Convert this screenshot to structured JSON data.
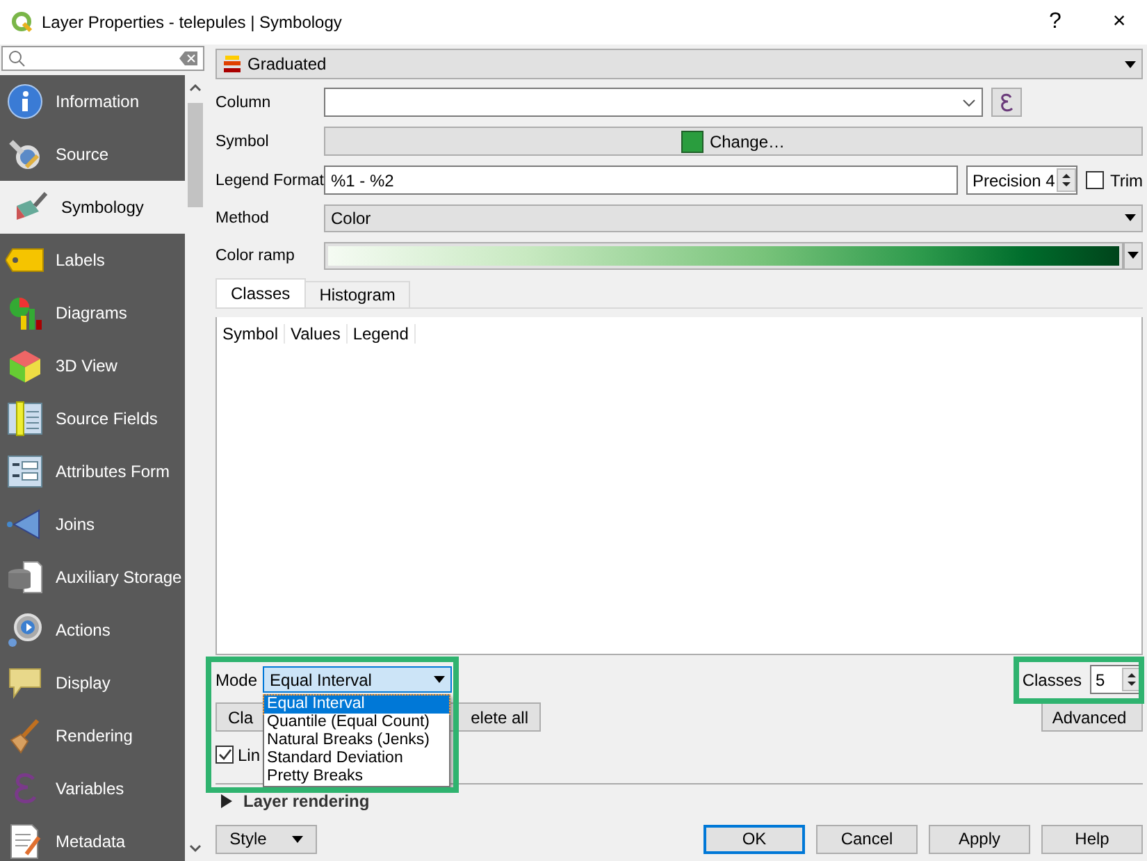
{
  "window": {
    "title": "Layer Properties - telepules | Symbology",
    "help_button": "?",
    "close_button": "×"
  },
  "sidebar": {
    "items": [
      {
        "label": "Information",
        "selected": false
      },
      {
        "label": "Source",
        "selected": false
      },
      {
        "label": "Symbology",
        "selected": true
      },
      {
        "label": "Labels",
        "selected": false
      },
      {
        "label": "Diagrams",
        "selected": false
      },
      {
        "label": "3D View",
        "selected": false
      },
      {
        "label": "Source Fields",
        "selected": false
      },
      {
        "label": "Attributes Form",
        "selected": false
      },
      {
        "label": "Joins",
        "selected": false
      },
      {
        "label": "Auxiliary Storage",
        "selected": false
      },
      {
        "label": "Actions",
        "selected": false
      },
      {
        "label": "Display",
        "selected": false
      },
      {
        "label": "Rendering",
        "selected": false
      },
      {
        "label": "Variables",
        "selected": false
      },
      {
        "label": "Metadata",
        "selected": false
      }
    ]
  },
  "renderer": {
    "value": "Graduated"
  },
  "form": {
    "column": {
      "label": "Column"
    },
    "symbol": {
      "label": "Symbol",
      "button": "Change…"
    },
    "legend_format": {
      "label": "Legend Format",
      "value": "%1 - %2",
      "precision": "Precision 4",
      "trim": {
        "label": "Trim",
        "checked": false
      }
    },
    "method": {
      "label": "Method",
      "value": "Color"
    },
    "color_ramp": {
      "label": "Color ramp"
    }
  },
  "tabs": [
    {
      "label": "Classes",
      "selected": true
    },
    {
      "label": "Histogram",
      "selected": false
    }
  ],
  "table": {
    "columns": [
      "Symbol",
      "Values",
      "Legend"
    ]
  },
  "mode": {
    "label": "Mode",
    "value": "Equal Interval",
    "options": [
      {
        "label": "Equal Interval",
        "selected": true
      },
      {
        "label": "Quantile (Equal Count)",
        "selected": false
      },
      {
        "label": "Natural Breaks (Jenks)",
        "selected": false
      },
      {
        "label": "Standard Deviation",
        "selected": false
      },
      {
        "label": "Pretty Breaks",
        "selected": false
      }
    ]
  },
  "classes": {
    "label": "Classes",
    "value": "5"
  },
  "actions": {
    "classify": "Cla",
    "delete_all": "elete all",
    "advanced": "Advanced"
  },
  "link": {
    "label": "Lin",
    "checked": true
  },
  "layer_rendering": {
    "label": "Layer rendering",
    "expanded": false
  },
  "footer": {
    "style": "Style",
    "buttons": [
      {
        "label": "OK",
        "default": true
      },
      {
        "label": "Cancel",
        "default": false
      },
      {
        "label": "Apply",
        "default": false
      },
      {
        "label": "Help",
        "default": false
      }
    ]
  }
}
